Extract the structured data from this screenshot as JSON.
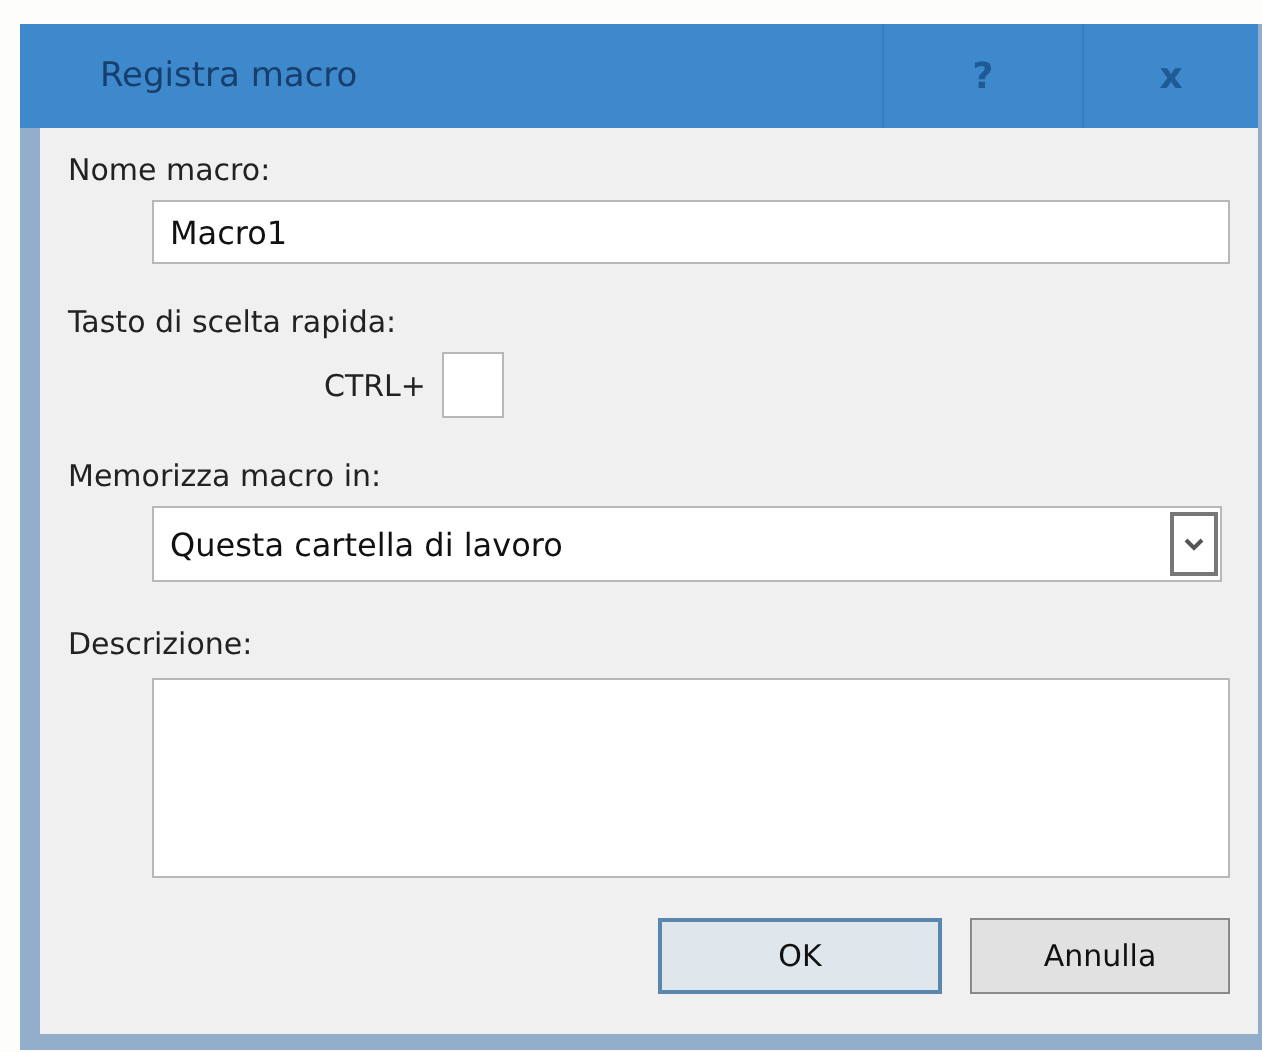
{
  "window": {
    "title": "Registra macro",
    "buttons": [
      {
        "kind": "help",
        "label": "?"
      },
      {
        "kind": "close",
        "label": "x"
      }
    ]
  },
  "name_field": {
    "label": "Nome macro:",
    "value": "Macro1"
  },
  "shortcut": {
    "label": "Tasto di scelta rapida:",
    "prefix": "CTRL+"
  },
  "store_in": {
    "label": "Memorizza macro in:",
    "value": "Questa cartella di lavoro"
  },
  "description": {
    "label": "Descrizione:"
  },
  "buttons": [
    {
      "label": "OK",
      "default": true
    },
    {
      "label": "Annulla",
      "default": false
    }
  ]
}
